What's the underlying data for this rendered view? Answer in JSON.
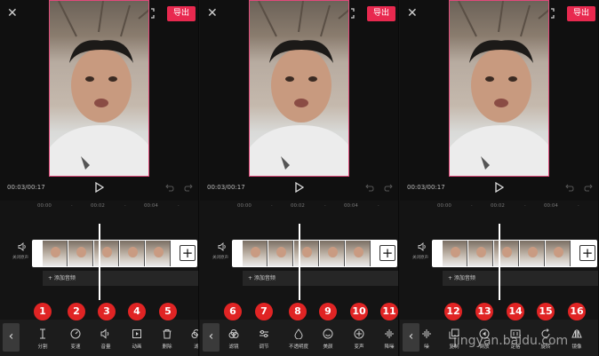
{
  "header": {
    "export_label": "导出"
  },
  "player": {
    "time": "00:03/00:17"
  },
  "ruler": {
    "ticks": [
      "00:00",
      "00:02",
      "00:04"
    ]
  },
  "timeline": {
    "audio_label": "关闭原声",
    "add_audio_label": "+ 添加音频"
  },
  "panels": [
    {
      "tools": [
        {
          "icon": "split-icon",
          "label": "分割"
        },
        {
          "icon": "speed-icon",
          "label": "变速"
        },
        {
          "icon": "volume-icon",
          "label": "音量"
        },
        {
          "icon": "animation-icon",
          "label": "动画"
        },
        {
          "icon": "delete-icon",
          "label": "删除"
        },
        {
          "icon": "filter-icon",
          "label": "滤"
        }
      ],
      "badges": [
        "1",
        "2",
        "3",
        "4",
        "5"
      ]
    },
    {
      "tools": [
        {
          "icon": "filter-icon",
          "label": "滤镜"
        },
        {
          "icon": "adjust-icon",
          "label": "调节"
        },
        {
          "icon": "opacity-icon",
          "label": "不透明度"
        },
        {
          "icon": "beauty-icon",
          "label": "美颜"
        },
        {
          "icon": "voice-change-icon",
          "label": "变声"
        },
        {
          "icon": "noise-reduction-icon",
          "label": "降噪"
        }
      ],
      "badges": [
        "6",
        "7",
        "8",
        "9",
        "10",
        "11"
      ]
    },
    {
      "tools": [
        {
          "icon": "noise-reduction-icon",
          "label": "噪"
        },
        {
          "icon": "copy-icon",
          "label": "复制"
        },
        {
          "icon": "reverse-icon",
          "label": "倒放"
        },
        {
          "icon": "freeze-icon",
          "label": "定格"
        },
        {
          "icon": "rotate-icon",
          "label": "旋转"
        },
        {
          "icon": "mirror-icon",
          "label": "镜像"
        }
      ],
      "badges": [
        "12",
        "13",
        "14",
        "15",
        "16"
      ]
    }
  ],
  "watermark": "jingyan.baidu.com",
  "colors": {
    "accent": "#e8294f",
    "badge": "#e02424",
    "background": "#141414"
  }
}
